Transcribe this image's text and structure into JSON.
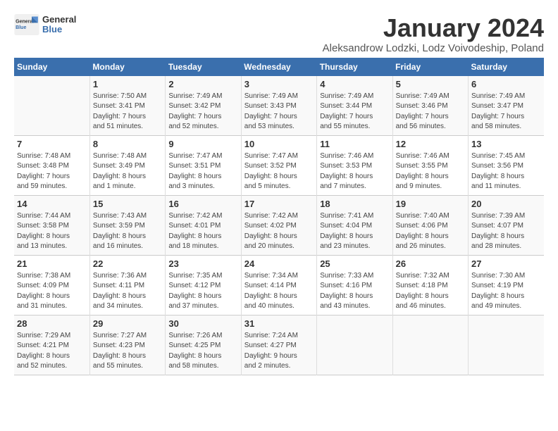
{
  "logo": {
    "line1": "General",
    "line2": "Blue"
  },
  "title": "January 2024",
  "subtitle": "Aleksandrow Lodzki, Lodz Voivodeship, Poland",
  "days_header": [
    "Sunday",
    "Monday",
    "Tuesday",
    "Wednesday",
    "Thursday",
    "Friday",
    "Saturday"
  ],
  "weeks": [
    [
      {
        "day": "",
        "info": ""
      },
      {
        "day": "1",
        "info": "Sunrise: 7:50 AM\nSunset: 3:41 PM\nDaylight: 7 hours\nand 51 minutes."
      },
      {
        "day": "2",
        "info": "Sunrise: 7:49 AM\nSunset: 3:42 PM\nDaylight: 7 hours\nand 52 minutes."
      },
      {
        "day": "3",
        "info": "Sunrise: 7:49 AM\nSunset: 3:43 PM\nDaylight: 7 hours\nand 53 minutes."
      },
      {
        "day": "4",
        "info": "Sunrise: 7:49 AM\nSunset: 3:44 PM\nDaylight: 7 hours\nand 55 minutes."
      },
      {
        "day": "5",
        "info": "Sunrise: 7:49 AM\nSunset: 3:46 PM\nDaylight: 7 hours\nand 56 minutes."
      },
      {
        "day": "6",
        "info": "Sunrise: 7:49 AM\nSunset: 3:47 PM\nDaylight: 7 hours\nand 58 minutes."
      }
    ],
    [
      {
        "day": "7",
        "info": "Sunrise: 7:48 AM\nSunset: 3:48 PM\nDaylight: 7 hours\nand 59 minutes."
      },
      {
        "day": "8",
        "info": "Sunrise: 7:48 AM\nSunset: 3:49 PM\nDaylight: 8 hours\nand 1 minute."
      },
      {
        "day": "9",
        "info": "Sunrise: 7:47 AM\nSunset: 3:51 PM\nDaylight: 8 hours\nand 3 minutes."
      },
      {
        "day": "10",
        "info": "Sunrise: 7:47 AM\nSunset: 3:52 PM\nDaylight: 8 hours\nand 5 minutes."
      },
      {
        "day": "11",
        "info": "Sunrise: 7:46 AM\nSunset: 3:53 PM\nDaylight: 8 hours\nand 7 minutes."
      },
      {
        "day": "12",
        "info": "Sunrise: 7:46 AM\nSunset: 3:55 PM\nDaylight: 8 hours\nand 9 minutes."
      },
      {
        "day": "13",
        "info": "Sunrise: 7:45 AM\nSunset: 3:56 PM\nDaylight: 8 hours\nand 11 minutes."
      }
    ],
    [
      {
        "day": "14",
        "info": "Sunrise: 7:44 AM\nSunset: 3:58 PM\nDaylight: 8 hours\nand 13 minutes."
      },
      {
        "day": "15",
        "info": "Sunrise: 7:43 AM\nSunset: 3:59 PM\nDaylight: 8 hours\nand 16 minutes."
      },
      {
        "day": "16",
        "info": "Sunrise: 7:42 AM\nSunset: 4:01 PM\nDaylight: 8 hours\nand 18 minutes."
      },
      {
        "day": "17",
        "info": "Sunrise: 7:42 AM\nSunset: 4:02 PM\nDaylight: 8 hours\nand 20 minutes."
      },
      {
        "day": "18",
        "info": "Sunrise: 7:41 AM\nSunset: 4:04 PM\nDaylight: 8 hours\nand 23 minutes."
      },
      {
        "day": "19",
        "info": "Sunrise: 7:40 AM\nSunset: 4:06 PM\nDaylight: 8 hours\nand 26 minutes."
      },
      {
        "day": "20",
        "info": "Sunrise: 7:39 AM\nSunset: 4:07 PM\nDaylight: 8 hours\nand 28 minutes."
      }
    ],
    [
      {
        "day": "21",
        "info": "Sunrise: 7:38 AM\nSunset: 4:09 PM\nDaylight: 8 hours\nand 31 minutes."
      },
      {
        "day": "22",
        "info": "Sunrise: 7:36 AM\nSunset: 4:11 PM\nDaylight: 8 hours\nand 34 minutes."
      },
      {
        "day": "23",
        "info": "Sunrise: 7:35 AM\nSunset: 4:12 PM\nDaylight: 8 hours\nand 37 minutes."
      },
      {
        "day": "24",
        "info": "Sunrise: 7:34 AM\nSunset: 4:14 PM\nDaylight: 8 hours\nand 40 minutes."
      },
      {
        "day": "25",
        "info": "Sunrise: 7:33 AM\nSunset: 4:16 PM\nDaylight: 8 hours\nand 43 minutes."
      },
      {
        "day": "26",
        "info": "Sunrise: 7:32 AM\nSunset: 4:18 PM\nDaylight: 8 hours\nand 46 minutes."
      },
      {
        "day": "27",
        "info": "Sunrise: 7:30 AM\nSunset: 4:19 PM\nDaylight: 8 hours\nand 49 minutes."
      }
    ],
    [
      {
        "day": "28",
        "info": "Sunrise: 7:29 AM\nSunset: 4:21 PM\nDaylight: 8 hours\nand 52 minutes."
      },
      {
        "day": "29",
        "info": "Sunrise: 7:27 AM\nSunset: 4:23 PM\nDaylight: 8 hours\nand 55 minutes."
      },
      {
        "day": "30",
        "info": "Sunrise: 7:26 AM\nSunset: 4:25 PM\nDaylight: 8 hours\nand 58 minutes."
      },
      {
        "day": "31",
        "info": "Sunrise: 7:24 AM\nSunset: 4:27 PM\nDaylight: 9 hours\nand 2 minutes."
      },
      {
        "day": "",
        "info": ""
      },
      {
        "day": "",
        "info": ""
      },
      {
        "day": "",
        "info": ""
      }
    ]
  ]
}
